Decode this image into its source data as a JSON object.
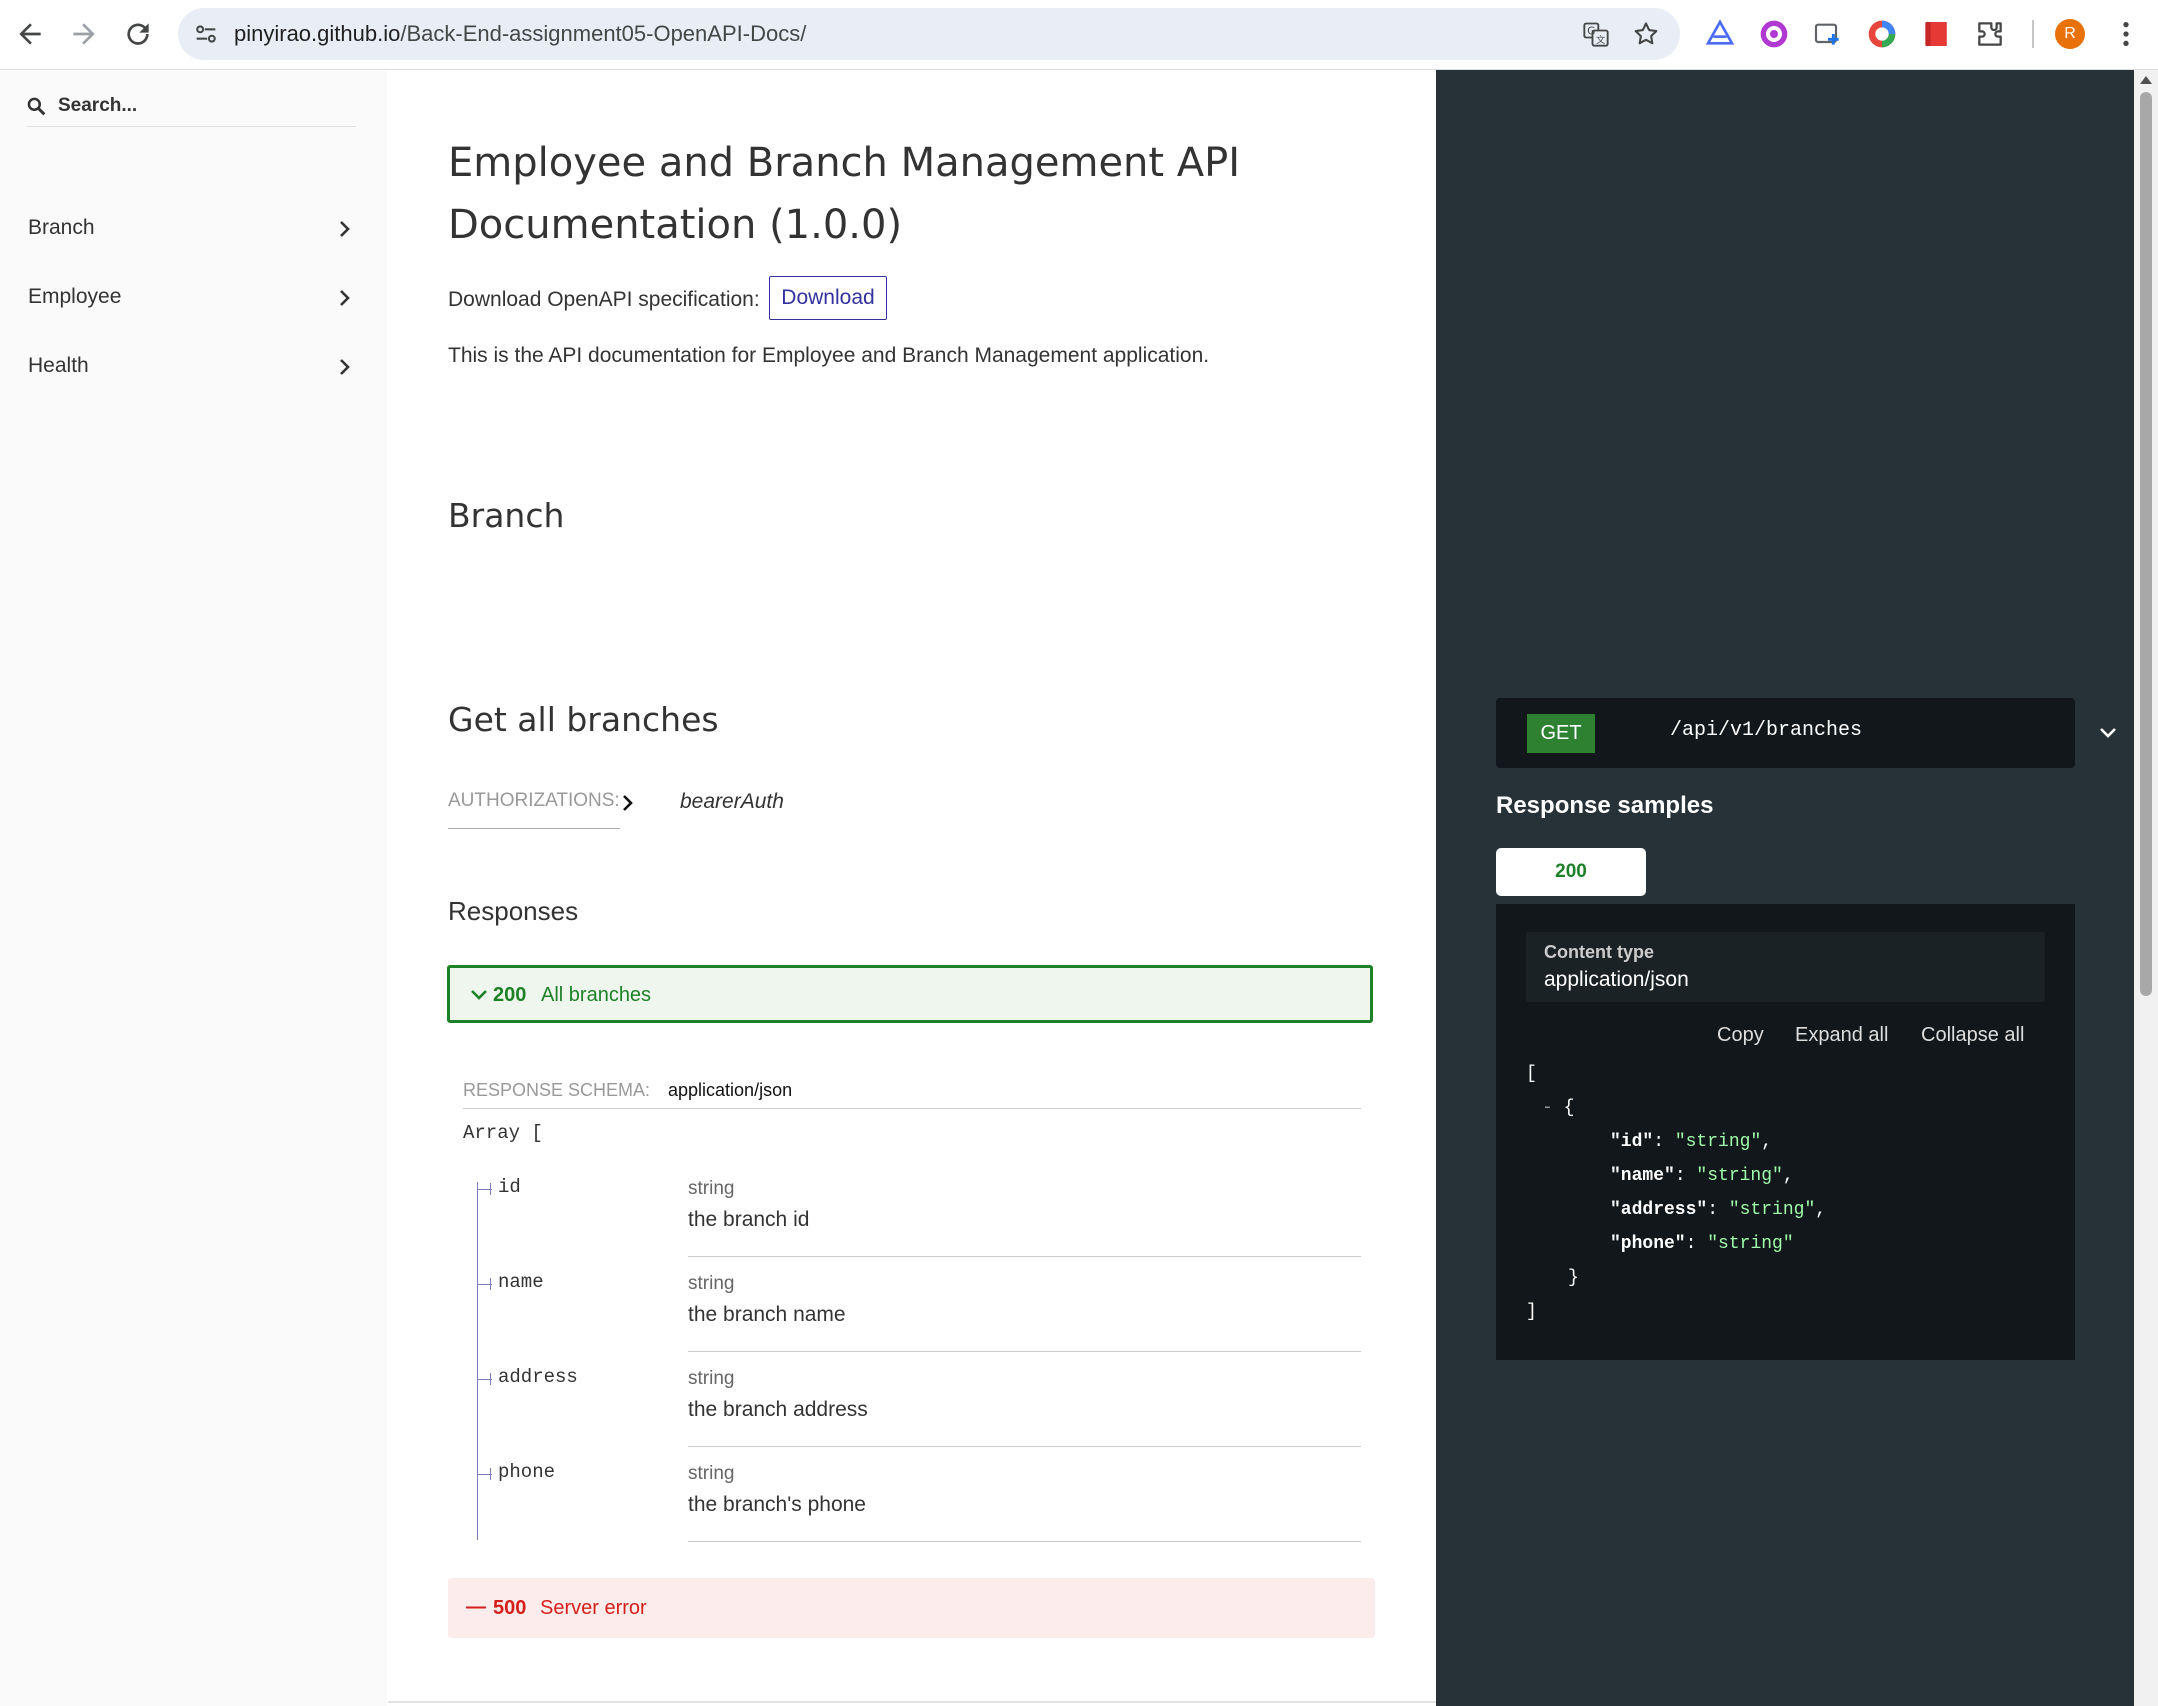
{
  "browser": {
    "url_domain": "pinyirao.github.io",
    "url_path": "/Back-End-assignment05-OpenAPI-Docs/",
    "avatar_letter": "R",
    "icons": [
      "back-arrow-icon",
      "forward-arrow-icon",
      "reload-icon",
      "site-info-icon",
      "translate-icon",
      "bookmark-star-icon",
      "extension-icons",
      "puzzle-extensions-icon",
      "kebab-menu-icon"
    ]
  },
  "sidebar": {
    "search_placeholder": "Search...",
    "items": [
      {
        "label": "Branch"
      },
      {
        "label": "Employee"
      },
      {
        "label": "Health"
      }
    ]
  },
  "main": {
    "title": "Employee and Branch Management API Documentation (1.0.0)",
    "download_label": "Download OpenAPI specification:",
    "download_button": "Download",
    "description": "This is the API documentation for Employee and Branch Management application.",
    "section_title": "Branch",
    "operation": {
      "title": "Get all branches",
      "auth_label": "AUTHORIZATIONS:",
      "auth_scheme": "bearerAuth",
      "responses_title": "Responses",
      "response_200": {
        "code": "200",
        "description": "All branches"
      },
      "schema_label": "RESPONSE SCHEMA:",
      "schema_type": "application/json",
      "array_open": "Array [",
      "array_close": "]",
      "properties": [
        {
          "name": "id",
          "type": "string",
          "description": "the branch id"
        },
        {
          "name": "name",
          "type": "string",
          "description": "the branch name"
        },
        {
          "name": "address",
          "type": "string",
          "description": "the branch address"
        },
        {
          "name": "phone",
          "type": "string",
          "description": "the branch's phone"
        }
      ],
      "response_500": {
        "dash": "—",
        "code": "500",
        "description": "Server error"
      }
    }
  },
  "right_panel": {
    "method": "GET",
    "path": "/api/v1/branches",
    "response_samples_title": "Response samples",
    "tab_label": "200",
    "content_type_label": "Content type",
    "content_type_value": "application/json",
    "actions": {
      "copy": "Copy",
      "expand_all": "Expand all",
      "collapse_all": "Collapse all"
    },
    "json": {
      "open_bracket": "[",
      "collapse_marker": "-",
      "open_brace": "{",
      "fields": [
        {
          "key": "\"id\"",
          "value": "\"string\"",
          "sep": ","
        },
        {
          "key": "\"name\"",
          "value": "\"string\"",
          "sep": ","
        },
        {
          "key": "\"address\"",
          "value": "\"string\"",
          "sep": ","
        },
        {
          "key": "\"phone\"",
          "value": "\"string\"",
          "sep": ""
        }
      ],
      "close_brace": "}",
      "close_bracket": "]"
    }
  },
  "colors": {
    "accent": "#32329f",
    "success": "#1d8127",
    "error": "#d41f1c",
    "panel_bg": "#263238",
    "json_string": "#a0fbaa"
  }
}
